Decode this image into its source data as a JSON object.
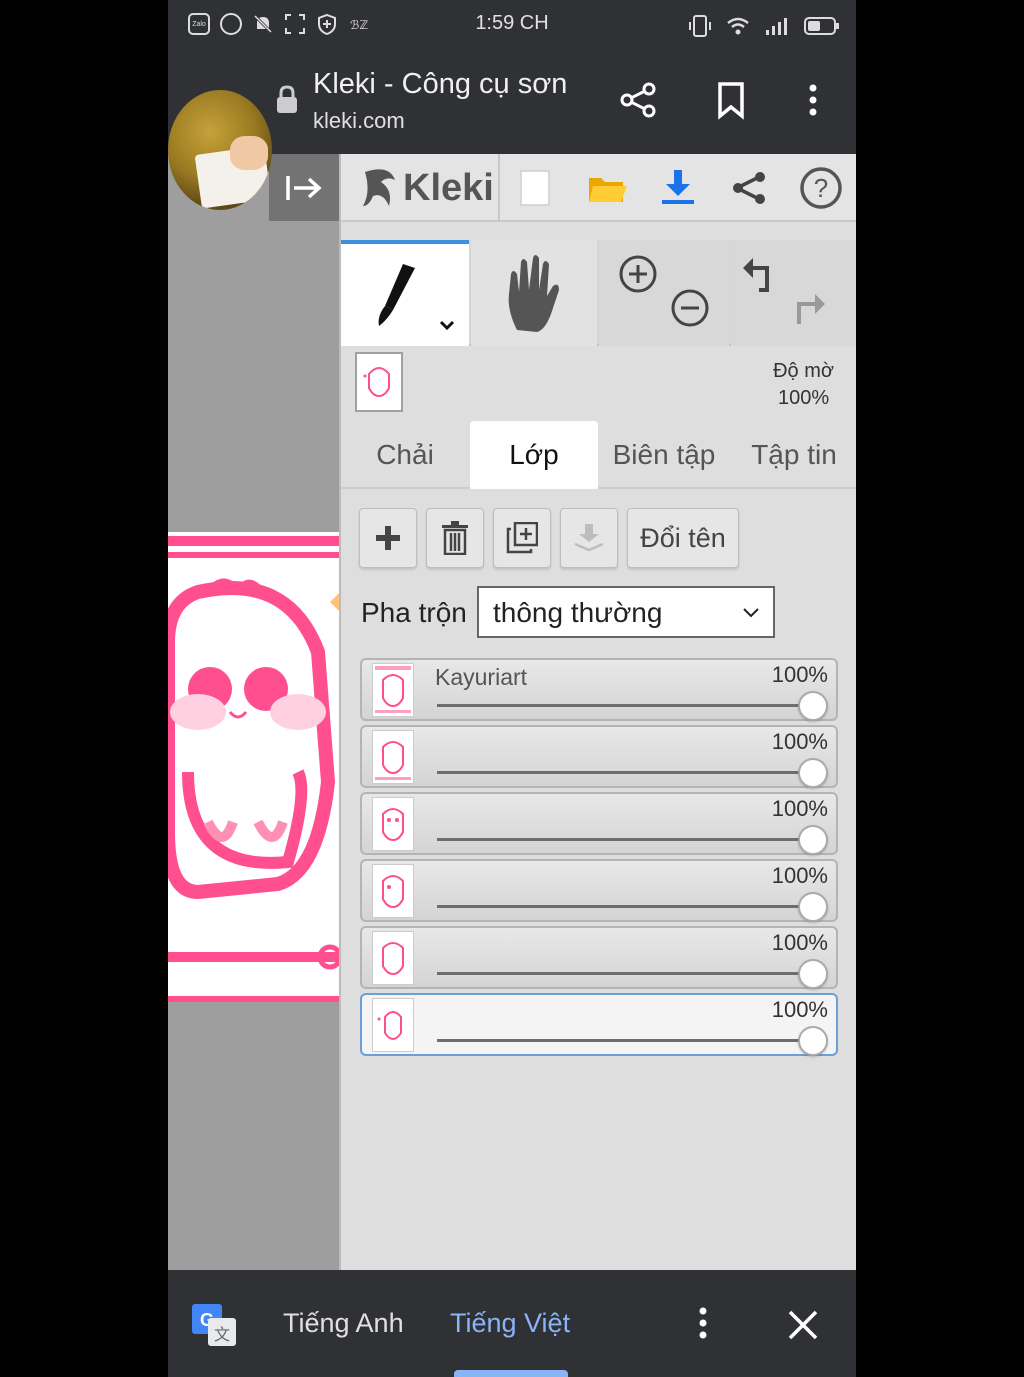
{
  "status_bar": {
    "time": "1:59 CH",
    "left_icons": [
      "zalo-icon",
      "messenger-icon",
      "mute-bell-icon",
      "screenshot-icon",
      "shield-icon",
      "shop-icon"
    ],
    "zalo_text": "Zalo",
    "right_icons": [
      "vibrate-icon",
      "wifi-icon",
      "signal-icon",
      "battery-icon"
    ]
  },
  "browser": {
    "title": "Kleki - Công cụ sơn",
    "url": "kleki.com",
    "icons": [
      "lock-icon",
      "share-icon",
      "bookmark-icon",
      "more-vert-icon"
    ]
  },
  "kleki": {
    "logo_text": "Kleki",
    "top_icons": [
      "new-image-icon",
      "open-folder-icon",
      "download-icon",
      "share-icon",
      "help-icon"
    ],
    "opacity_label": "Độ mờ",
    "opacity_value": "100%",
    "tabs": [
      {
        "label": "Chải",
        "active": false
      },
      {
        "label": "Lớp",
        "active": true
      },
      {
        "label": "Biên tập",
        "active": false
      },
      {
        "label": "Tập tin",
        "active": false
      }
    ],
    "layer_buttons": {
      "add": "add-layer-icon",
      "delete": "trash-icon",
      "duplicate": "duplicate-icon",
      "merge": "merge-down-icon",
      "rename_label": "Đổi tên"
    },
    "blend": {
      "label": "Pha trộn",
      "value": "thông thường"
    },
    "layers": [
      {
        "name": "Kayuriart",
        "opacity": "100%",
        "opacity_fraction": 1.0,
        "selected": false
      },
      {
        "name": "",
        "opacity": "100%",
        "opacity_fraction": 1.0,
        "selected": false
      },
      {
        "name": "",
        "opacity": "100%",
        "opacity_fraction": 1.0,
        "selected": false
      },
      {
        "name": "",
        "opacity": "100%",
        "opacity_fraction": 1.0,
        "selected": false
      },
      {
        "name": "",
        "opacity": "100%",
        "opacity_fraction": 1.0,
        "selected": false
      },
      {
        "name": "",
        "opacity": "100%",
        "opacity_fraction": 1.0,
        "selected": true
      }
    ]
  },
  "translate_bar": {
    "source_lang": "Tiếng Anh",
    "target_lang": "Tiếng Việt",
    "icons": [
      "google-translate-icon",
      "more-vert-icon",
      "close-icon"
    ]
  },
  "colors": {
    "accent_blue": "#1a73e8",
    "translate_active": "#8ab4f8",
    "pink": "#ff4f8f"
  }
}
